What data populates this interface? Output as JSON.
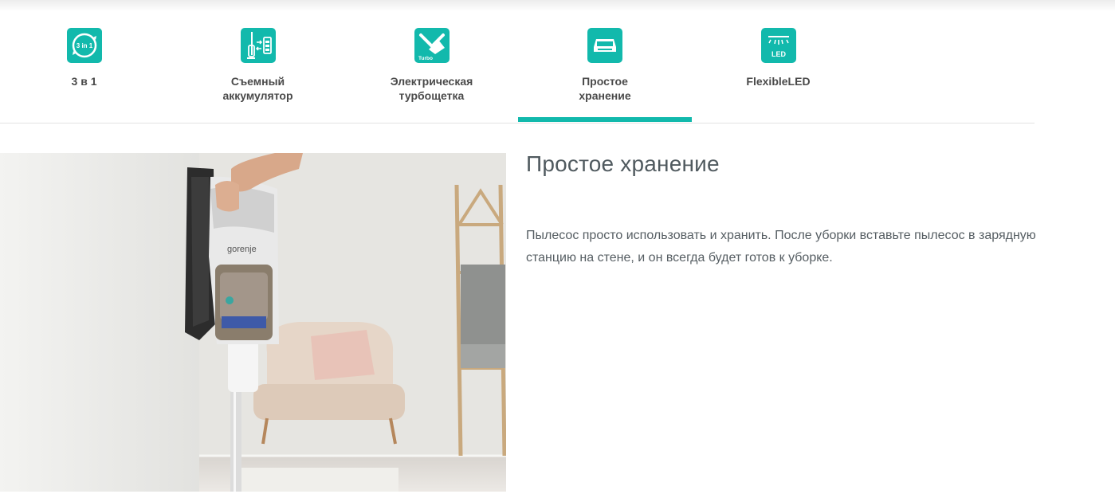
{
  "tabs": [
    {
      "id": "3in1",
      "label": "3 в 1",
      "icon": "3-in-1-icon",
      "icon_text": "3 in 1",
      "active": false
    },
    {
      "id": "battery",
      "label": "Съемный\nаккумулятор",
      "icon": "removable-battery-icon",
      "active": false
    },
    {
      "id": "turbo",
      "label": "Электрическая\nтурбощетка",
      "icon": "turbo-brush-icon",
      "icon_text": "Turbo",
      "active": false
    },
    {
      "id": "storage",
      "label": "Простое\nхранение",
      "icon": "storage-station-icon",
      "active": true
    },
    {
      "id": "led",
      "label": "FlexibleLED",
      "icon": "flexible-led-icon",
      "icon_text": "LED",
      "active": false
    }
  ],
  "content": {
    "title": "Простое хранение",
    "description": "Пылесос просто использовать и хранить. После уборки вставьте пылесос в зарядную станцию на стене, и он всегда будет готов к уборке.",
    "image": {
      "alt": "",
      "brand_text": "gorenje"
    }
  },
  "colors": {
    "accent": "#12b9ac",
    "label_text": "#4a4a4a",
    "title_text": "#505a5f",
    "body_text": "#555d62",
    "divider": "#e3e3e3"
  }
}
